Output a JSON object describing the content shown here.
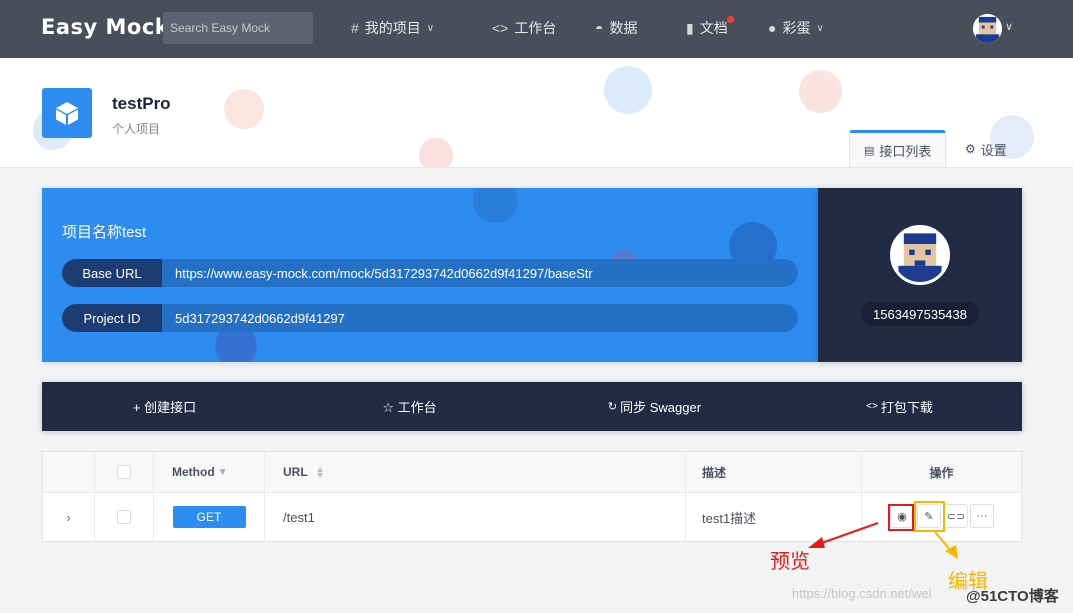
{
  "nav": {
    "logo": "Easy Mock",
    "search_placeholder": "Search Easy Mock",
    "items": [
      {
        "label": "我的项目",
        "icon": "hash-icon"
      },
      {
        "label": "工作台",
        "icon": "code-arrows-icon"
      },
      {
        "label": "数据",
        "icon": "dashboard-icon"
      },
      {
        "label": "文档",
        "icon": "book-icon"
      },
      {
        "label": "彩蛋",
        "icon": "egg-icon"
      }
    ]
  },
  "project": {
    "name": "testPro",
    "subtitle": "个人项目",
    "tabs": [
      {
        "label": "接口列表",
        "icon": "list-icon"
      },
      {
        "label": "设置",
        "icon": "gear-icon"
      }
    ]
  },
  "info": {
    "title": "项目名称test",
    "base_url_key": "Base URL",
    "base_url_value": "https://www.easy-mock.com/mock/5d317293742d0662d9f41297/baseStr",
    "project_id_key": "Project ID",
    "project_id_value": "5d317293742d0662d9f41297"
  },
  "owner": {
    "id": "1563497535438"
  },
  "toolbar": {
    "create": "+ 创建接口",
    "workbench": "☆ 工作台",
    "sync": "同步 Swagger",
    "download": "打包下载"
  },
  "table": {
    "headers": {
      "method": "Method",
      "url": "URL",
      "desc": "描述",
      "ops": "操作"
    },
    "rows": [
      {
        "method": "GET",
        "url": "/test1",
        "desc": "test1描述"
      }
    ]
  },
  "annotations": {
    "preview": "预览",
    "edit": "编辑",
    "watermark": "https://blog.csdn.net/wei",
    "brand": "@51CTO博客"
  },
  "colors": {
    "nav_bg": "#4a4e5a",
    "primary": "#2d8cf0",
    "dark_panel": "#232a44",
    "annotation_red": "#e41b1b",
    "annotation_yellow": "#f5b800"
  }
}
